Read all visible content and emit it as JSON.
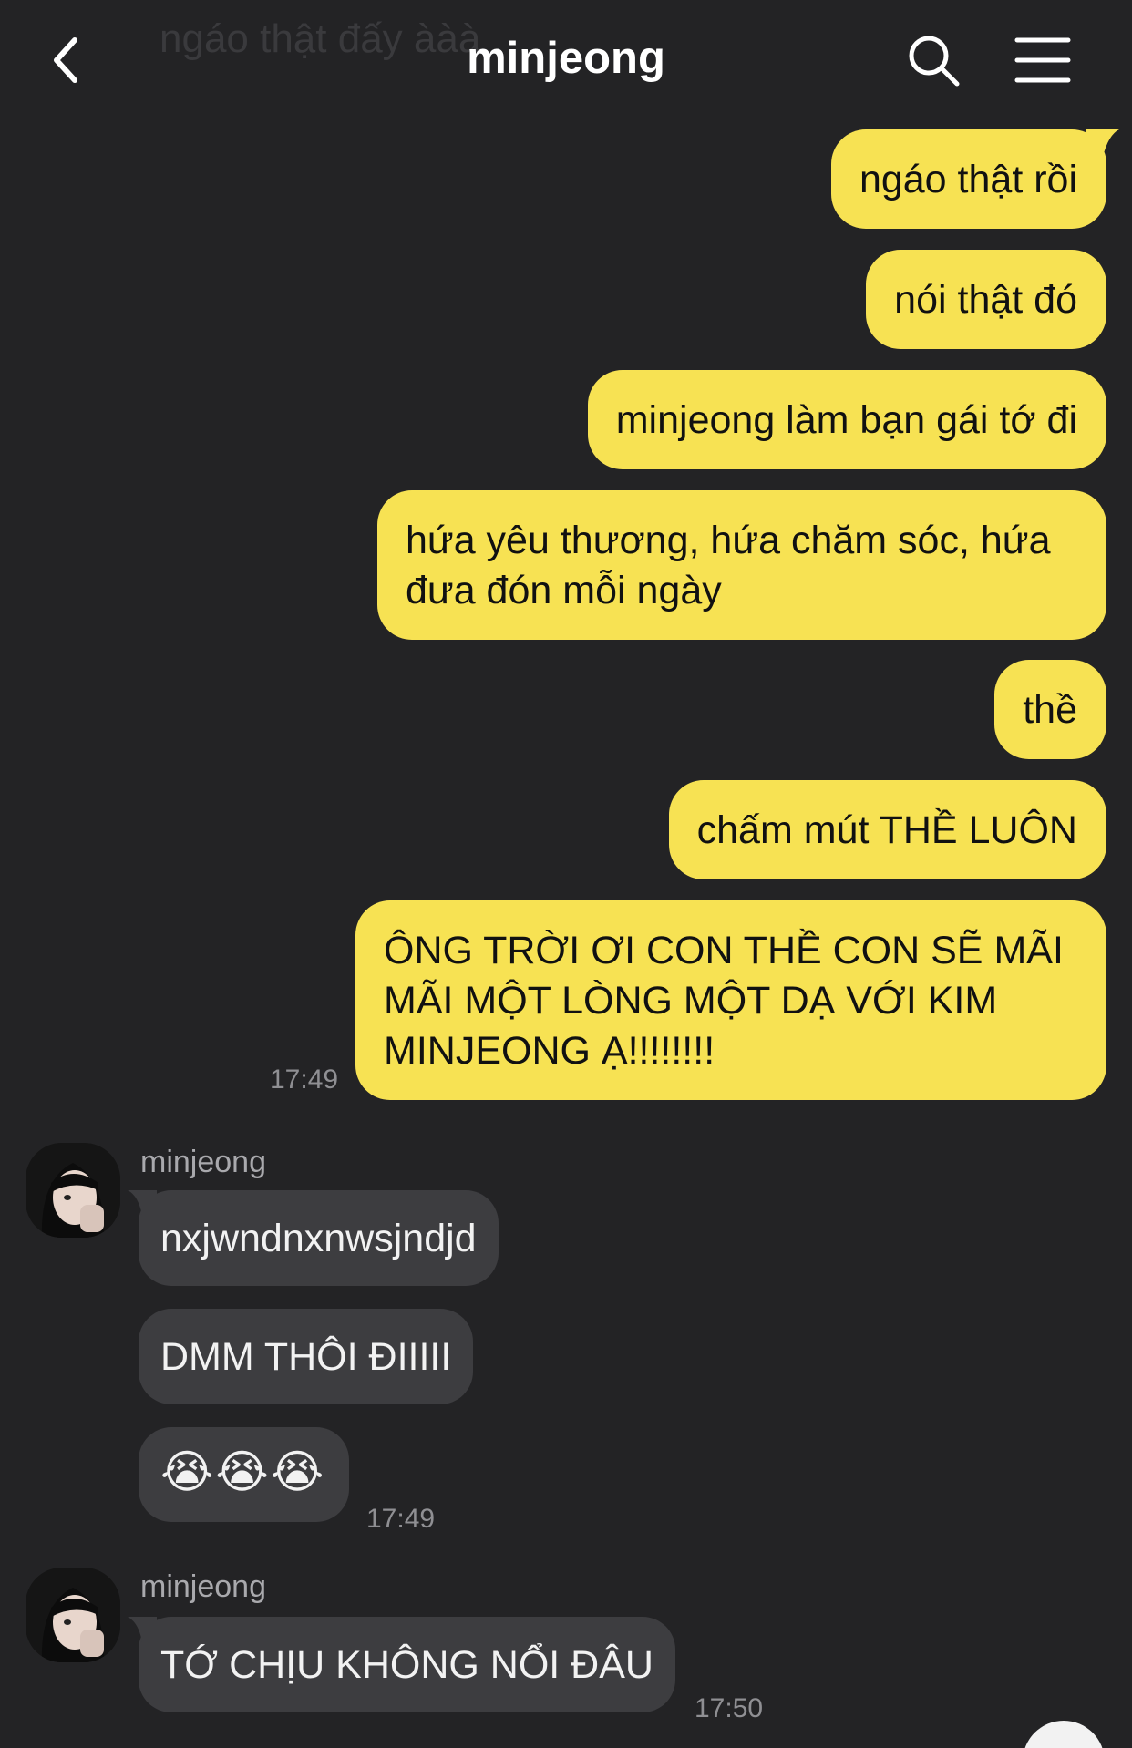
{
  "header": {
    "ghost_text": "ngáo thật đấy ààà",
    "title": "minjeong"
  },
  "sent_messages": [
    "ngáo thật rồi",
    "nói thật đó",
    "minjeong làm bạn gái tớ đi",
    "hứa yêu thương, hứa chăm sóc, hứa đưa đón mỗi ngày",
    "thề",
    "chấm mút THỀ LUÔN",
    "ÔNG TRỜI ƠI CON THỀ CON SẼ MÃI MÃI MỘT LÒNG MỘT DẠ VỚI KIM MINJEONG Ạ!!!!!!!!"
  ],
  "sent_time": "17:49",
  "group1": {
    "sender": "minjeong",
    "messages": [
      "nxjwndnxnwsjndjd",
      "DMM THÔI ĐIIIII"
    ],
    "emoji_message": "😭😭😭",
    "time": "17:49"
  },
  "group2": {
    "sender": "minjeong",
    "messages": [
      "TỚ CHỊU KHÔNG NỔI ĐÂU"
    ],
    "time": "17:50"
  },
  "colors": {
    "background": "#232325",
    "sent_bubble": "#f7e253",
    "received_bubble": "#3d3d40"
  }
}
